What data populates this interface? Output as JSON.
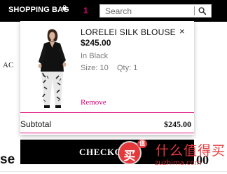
{
  "header": {
    "bag_label": "SHOPPING BAG",
    "bag_count": "1",
    "search_placeholder": "Search"
  },
  "background_page": {
    "fragment_left": "AC",
    "fragment_bottom": "se",
    "fragment_price": "00"
  },
  "cart": {
    "item": {
      "name": "LORELEI SILK BLOUSE",
      "price": "$245.00",
      "color": "In Black",
      "size": "Size: 10",
      "qty": "Qty: 1",
      "remove_x": "×",
      "remove_label": "Remove",
      "image": "black-silk-blouse-model"
    },
    "subtotal_label": "Subtotal",
    "subtotal_value": "$245.00",
    "checkout_label": "CHECKOUT"
  },
  "watermark": {
    "circle_glyph": "买",
    "badge": "值",
    "text": "什么值得买",
    "url": "zuzhima.com"
  },
  "colors": {
    "accent_pink": "#e0157f",
    "header_bg": "#000000",
    "watermark_red": "#e4383b"
  },
  "icons": {
    "search": "search-icon",
    "bag": "bag-icon",
    "close": "close-icon"
  }
}
